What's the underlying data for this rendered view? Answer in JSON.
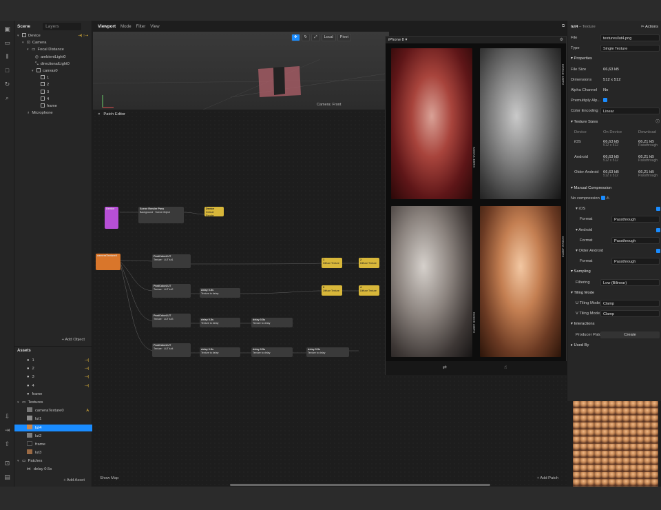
{
  "scene": {
    "tab_scene": "Scene",
    "tab_layers": "Layers",
    "items": [
      {
        "label": "Device",
        "badge": "⇥| ↑⇢"
      },
      {
        "label": "Camera",
        "badge": ""
      },
      {
        "label": "Focal Distance",
        "badge": ""
      },
      {
        "label": "ambientLight0",
        "badge": ""
      },
      {
        "label": "directionalLight0",
        "badge": ""
      },
      {
        "label": "canvas0",
        "badge": ""
      },
      {
        "label": "1",
        "badge": ""
      },
      {
        "label": "2",
        "badge": ""
      },
      {
        "label": "3",
        "badge": ""
      },
      {
        "label": "4",
        "badge": ""
      },
      {
        "label": "frame",
        "badge": ""
      },
      {
        "label": "Microphone",
        "badge": ""
      }
    ],
    "add_object": "+ Add Object"
  },
  "assets": {
    "title": "Assets",
    "items": [
      {
        "label": "1",
        "badge": "⇢|"
      },
      {
        "label": "2",
        "badge": "⇢|"
      },
      {
        "label": "3",
        "badge": "⇢|"
      },
      {
        "label": "4",
        "badge": "⇢|"
      },
      {
        "label": "frame",
        "badge": ""
      },
      {
        "label": "Textures",
        "badge": ""
      },
      {
        "label": "cameraTexture0",
        "badge": "A"
      },
      {
        "label": "lut1",
        "badge": ""
      },
      {
        "label": "lut4",
        "badge": ""
      },
      {
        "label": "lut2",
        "badge": ""
      },
      {
        "label": "frame",
        "badge": ""
      },
      {
        "label": "lut3",
        "badge": ""
      },
      {
        "label": "Patches",
        "badge": ""
      },
      {
        "label": "delay 0.5s",
        "badge": ""
      }
    ],
    "add_asset": "+ Add Asset"
  },
  "viewport": {
    "menu": [
      "Viewport",
      "Mode",
      "Filter",
      "View"
    ],
    "local": "Local",
    "pivot": "Pivot",
    "camera_label": "Camera: Front"
  },
  "patch_editor": {
    "title": "Patch Editor",
    "show_map": "Show Map",
    "add_patch": "+ Add Patch",
    "nodes": [
      {
        "title": "Device",
        "sub": ""
      },
      {
        "title": "Scene Render Pass",
        "sub": "Background · Scene Object"
      },
      {
        "title": "Device",
        "sub": "Default Render"
      },
      {
        "title": "cameraTexture0",
        "sub": ""
      },
      {
        "title": "PastColorLUT",
        "sub": "Texture · LUT lut1"
      },
      {
        "title": "PastColorLUT",
        "sub": "Texture · LUT lut2"
      },
      {
        "title": "PastColorLUT",
        "sub": "Texture · LUT lut3"
      },
      {
        "title": "PastColorLUT",
        "sub": "Texture · LUT lut4"
      },
      {
        "title": "delay 0.5s",
        "sub": "Texture to delay"
      },
      {
        "title": "delay 0.5s",
        "sub": "Texture to delay"
      },
      {
        "title": "delay 0.5s",
        "sub": "Texture to delay"
      },
      {
        "title": "delay 0.5s",
        "sub": "Texture to delay"
      },
      {
        "title": "delay 0.5s",
        "sub": "Texture to delay"
      },
      {
        "title": "delay 0.5s",
        "sub": "Texture to delay"
      },
      {
        "title": "1",
        "sub": "Diffuse Texture"
      },
      {
        "title": "2",
        "sub": "Diffuse Texture"
      },
      {
        "title": "3",
        "sub": "Diffuse Texture"
      },
      {
        "title": "4",
        "sub": "Diffuse Texture"
      }
    ]
  },
  "simulator": {
    "device": "iPhone 8",
    "film_labels": [
      "KODAK 400TX",
      "KODAK 400TX",
      "KODAK 400TX",
      "KODAK 400TX"
    ]
  },
  "properties": {
    "title": "lut4",
    "subtitle": "– Texture",
    "actions": "Actions",
    "file_label": "File",
    "file_value": "textures/lut4.png",
    "type_label": "Type",
    "type_value": "Single Texture",
    "properties_header": "Properties",
    "file_size_label": "File Size",
    "file_size_value": "66,63 kB",
    "dimensions_label": "Dimensions",
    "dimensions_value": "512 x 512",
    "alpha_label": "Alpha Channel",
    "alpha_value": "No",
    "premult_label": "Premultiply Alp...",
    "color_enc_label": "Color Encoding",
    "color_enc_value": "Linear",
    "tex_sizes_header": "Texture Sizes",
    "col_device": "Device",
    "col_on_device": "On Device",
    "col_download": "Download",
    "size_rows": [
      {
        "device": "iOS",
        "on": "66,63 kB",
        "on_sub": "512 x 512",
        "dl": "66,21 kB",
        "dl_sub": "Passthrough"
      },
      {
        "device": "Android",
        "on": "66,63 kB",
        "on_sub": "512 x 512",
        "dl": "66,21 kB",
        "dl_sub": "Passthrough"
      },
      {
        "device": "Older Android",
        "on": "66,63 kB",
        "on_sub": "512 x 512",
        "dl": "66,21 kB",
        "dl_sub": "Passthrough"
      }
    ],
    "manual_header": "Manual Compression",
    "no_comp_label": "No compression",
    "ios_label": "iOS",
    "android_label": "Android",
    "older_android_label": "Older Android",
    "format_label": "Format",
    "format_value": "Passthrough",
    "sampling_header": "Sampling",
    "filtering_label": "Filtering",
    "filtering_value": "Low (Bilinear)",
    "tiling_header": "Tiling Mode",
    "u_tiling_label": "U Tiling Mode",
    "v_tiling_label": "V Tiling Mode",
    "tiling_value": "Clamp",
    "interactions_header": "Interactions",
    "producer_label": "Producer Patch",
    "create_label": "Create",
    "used_by_header": "Used By"
  }
}
